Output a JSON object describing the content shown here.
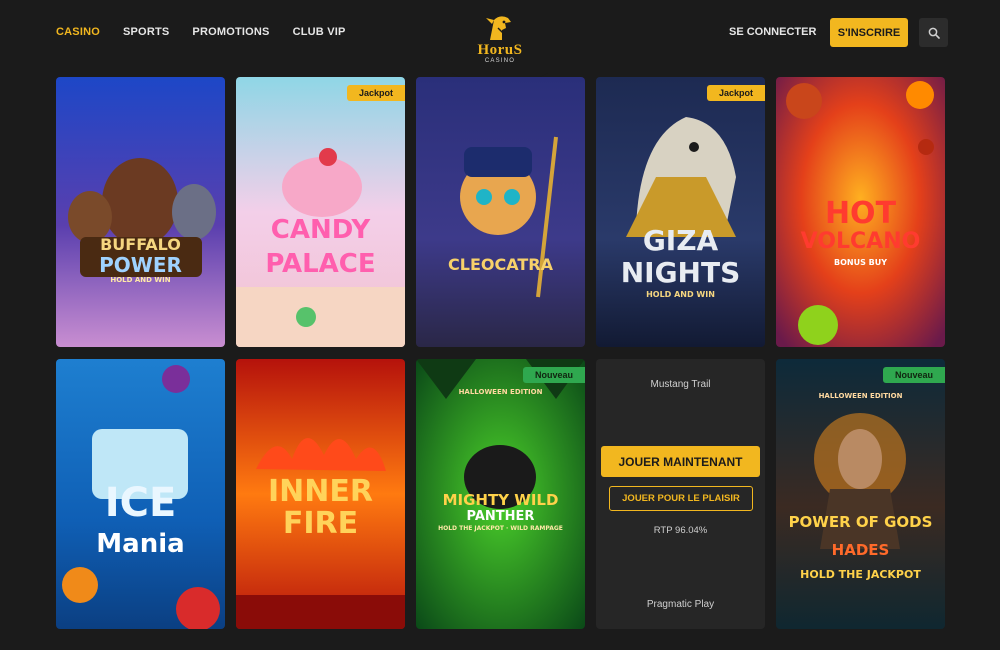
{
  "nav": {
    "items": [
      {
        "label": "CASINO",
        "active": true
      },
      {
        "label": "SPORTS"
      },
      {
        "label": "PROMOTIONS"
      },
      {
        "label": "CLUB VIP"
      }
    ]
  },
  "logo": {
    "name": "HoruS",
    "sub": "CASINO"
  },
  "header": {
    "login_label": "SE CONNECTER",
    "signup_label": "S'INSCRIRE",
    "search_icon": "search-icon"
  },
  "colors": {
    "accent": "#f2b71f",
    "background": "#1b1b1b",
    "badge_new": "#2fa84f"
  },
  "games": [
    {
      "title_line1": "BUFFALO",
      "title_line2": "POWER",
      "tagline": "HOLD AND WIN",
      "badge": ""
    },
    {
      "title_line1": "CANDY",
      "title_line2": "PALACE",
      "tagline": "",
      "badge": "Jackpot"
    },
    {
      "title_line1": "CLEOCATRA",
      "title_line2": "",
      "tagline": "",
      "badge": ""
    },
    {
      "title_line1": "GIZA",
      "title_line2": "NIGHTS",
      "tagline": "HOLD AND WIN",
      "badge": "Jackpot"
    },
    {
      "title_line1": "HOT",
      "title_line2": "VOLCANO",
      "tagline": "BONUS BUY",
      "badge": ""
    },
    {
      "title_line1": "ICE",
      "title_line2": "Mania",
      "tagline": "",
      "badge": ""
    },
    {
      "title_line1": "INNER",
      "title_line2": "FIRE",
      "tagline": "",
      "badge": ""
    },
    {
      "title_line1": "MIGHTY WILD",
      "title_line2": "PANTHER",
      "tagline": "HOLD THE JACKPOT · WILD RAMPAGE",
      "edition": "HALLOWEEN EDITION",
      "badge": "Nouveau"
    },
    {
      "name": "Mustang Trail",
      "play_label": "JOUER MAINTENANT",
      "demo_label": "JOUER POUR LE PLAISIR",
      "rtp": "RTP 96.04%",
      "provider": "Pragmatic Play"
    },
    {
      "title_line1": "POWER OF GODS",
      "title_line2": "HADES",
      "tagline": "HOLD THE JACKPOT",
      "edition": "HALLOWEEN EDITION",
      "badge": "Nouveau"
    }
  ]
}
